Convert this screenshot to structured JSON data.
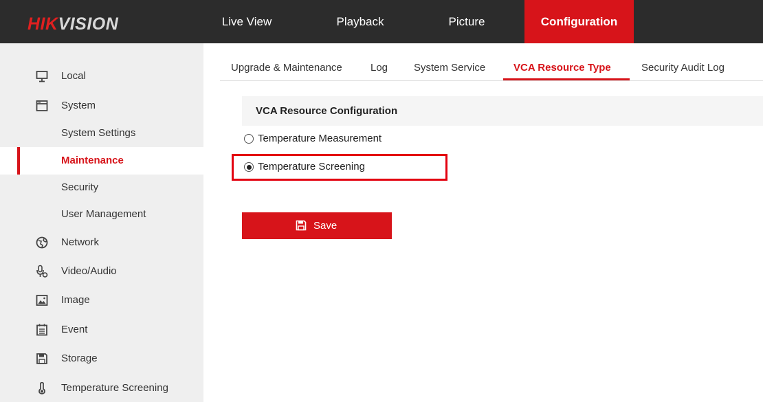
{
  "brand": {
    "logo_part1": "HIK",
    "logo_part2": "VISION"
  },
  "topnav": [
    {
      "label": "Live View"
    },
    {
      "label": "Playback"
    },
    {
      "label": "Picture"
    },
    {
      "label": "Configuration",
      "active": true
    }
  ],
  "sidebar": {
    "items": [
      {
        "label": "Local",
        "icon": "monitor-icon"
      },
      {
        "label": "System",
        "icon": "system-window-icon"
      },
      {
        "label": "System Settings"
      },
      {
        "label": "Maintenance",
        "selected": true
      },
      {
        "label": "Security"
      },
      {
        "label": "User Management"
      },
      {
        "label": "Network",
        "icon": "globe-icon"
      },
      {
        "label": "Video/Audio",
        "icon": "microphone-icon"
      },
      {
        "label": "Image",
        "icon": "image-icon"
      },
      {
        "label": "Event",
        "icon": "calendar-icon"
      },
      {
        "label": "Storage",
        "icon": "floppy-disk-icon"
      },
      {
        "label": "Temperature Screening",
        "icon": "thermometer-icon"
      }
    ]
  },
  "subtabs": [
    {
      "label": "Upgrade & Maintenance"
    },
    {
      "label": "Log"
    },
    {
      "label": "System Service"
    },
    {
      "label": "VCA Resource Type",
      "active": true
    },
    {
      "label": "Security Audit Log"
    }
  ],
  "content": {
    "section_title": "VCA Resource Configuration",
    "options": [
      {
        "label": "Temperature Measurement",
        "checked": false
      },
      {
        "label": "Temperature Screening",
        "checked": true
      }
    ],
    "save_label": "Save"
  },
  "colors": {
    "accent": "#d7141a",
    "topbar": "#2c2c2c",
    "sidebar": "#efefef",
    "highlight": "#e3000f"
  }
}
